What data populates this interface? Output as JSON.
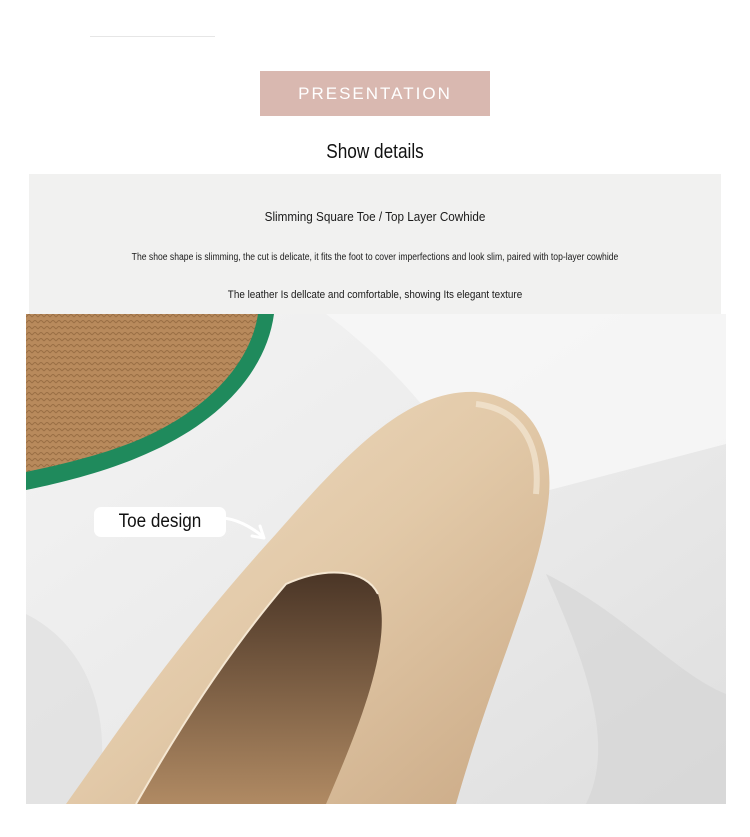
{
  "banner": {
    "label": "PRESENTATION"
  },
  "section": {
    "title": "Show details"
  },
  "info": {
    "heading": "Slimming Square Toe / Top Layer Cowhide",
    "line_1": "The shoe shape is slimming, the cut is delicate, it fits the foot to cover imperfections and look slim, paired with top-layer cowhide",
    "line_2": "The leather Is dellcate and comfortable, showing Its elegant texture"
  },
  "photo": {
    "callout_label": "Toe design"
  },
  "colors": {
    "banner_bg": "#d9b8b0",
    "panel_bg": "#f1f1f0",
    "shoe_leather": "#e2c9a8",
    "hat_trim": "#1f8a5c"
  }
}
